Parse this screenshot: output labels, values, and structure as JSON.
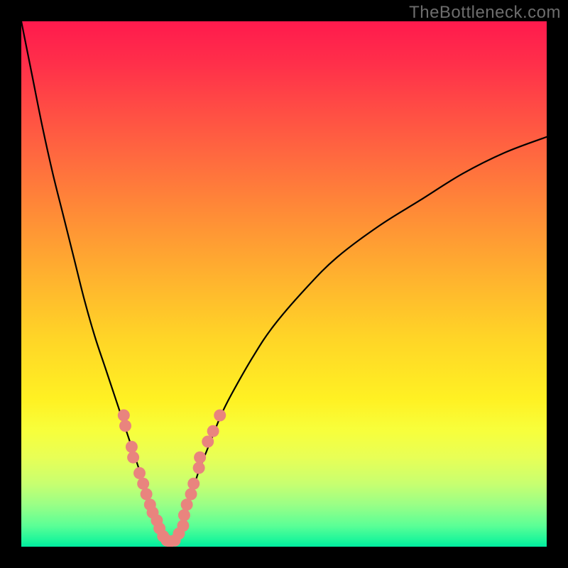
{
  "watermark": "TheBottleneck.com",
  "chart_data": {
    "type": "line",
    "title": "",
    "xlabel": "",
    "ylabel": "",
    "xlim": [
      0,
      100
    ],
    "ylim": [
      0,
      100
    ],
    "gradient_colors": {
      "top": "#ff1a4d",
      "middle": "#ffd427",
      "bottom": "#00eaa0"
    },
    "series": [
      {
        "name": "left-curve",
        "x": [
          0,
          2,
          4,
          6,
          8,
          10,
          12,
          14,
          16,
          18,
          20,
          21,
          22,
          23,
          24,
          25,
          26,
          27,
          28
        ],
        "values": [
          100,
          90,
          80,
          71,
          63,
          55,
          47,
          40,
          34,
          28,
          22,
          19,
          16,
          13,
          10,
          7,
          5,
          3,
          1
        ]
      },
      {
        "name": "right-curve",
        "x": [
          29,
          30,
          31,
          32,
          33,
          34,
          36,
          38,
          40,
          44,
          48,
          54,
          60,
          68,
          76,
          84,
          92,
          100
        ],
        "values": [
          1,
          3,
          6,
          9,
          12,
          15,
          20,
          25,
          29,
          36,
          42,
          49,
          55,
          61,
          66,
          71,
          75,
          78
        ]
      }
    ],
    "scatter_points": {
      "name": "highlighted-points",
      "color": "#e9847e",
      "points": [
        {
          "x": 19.5,
          "y": 25
        },
        {
          "x": 19.8,
          "y": 23
        },
        {
          "x": 21.0,
          "y": 19
        },
        {
          "x": 21.3,
          "y": 17
        },
        {
          "x": 22.5,
          "y": 14
        },
        {
          "x": 23.2,
          "y": 12
        },
        {
          "x": 23.8,
          "y": 10
        },
        {
          "x": 24.5,
          "y": 8
        },
        {
          "x": 25.0,
          "y": 6.5
        },
        {
          "x": 25.8,
          "y": 5
        },
        {
          "x": 26.3,
          "y": 3.5
        },
        {
          "x": 27.0,
          "y": 2
        },
        {
          "x": 27.7,
          "y": 1.2
        },
        {
          "x": 28.3,
          "y": 1
        },
        {
          "x": 29.2,
          "y": 1.2
        },
        {
          "x": 30.0,
          "y": 2.5
        },
        {
          "x": 30.8,
          "y": 4
        },
        {
          "x": 31.0,
          "y": 6
        },
        {
          "x": 31.5,
          "y": 8
        },
        {
          "x": 32.3,
          "y": 10
        },
        {
          "x": 32.8,
          "y": 12
        },
        {
          "x": 33.8,
          "y": 15
        },
        {
          "x": 34.0,
          "y": 17
        },
        {
          "x": 35.5,
          "y": 20
        },
        {
          "x": 36.5,
          "y": 22
        },
        {
          "x": 37.8,
          "y": 25
        }
      ]
    }
  }
}
